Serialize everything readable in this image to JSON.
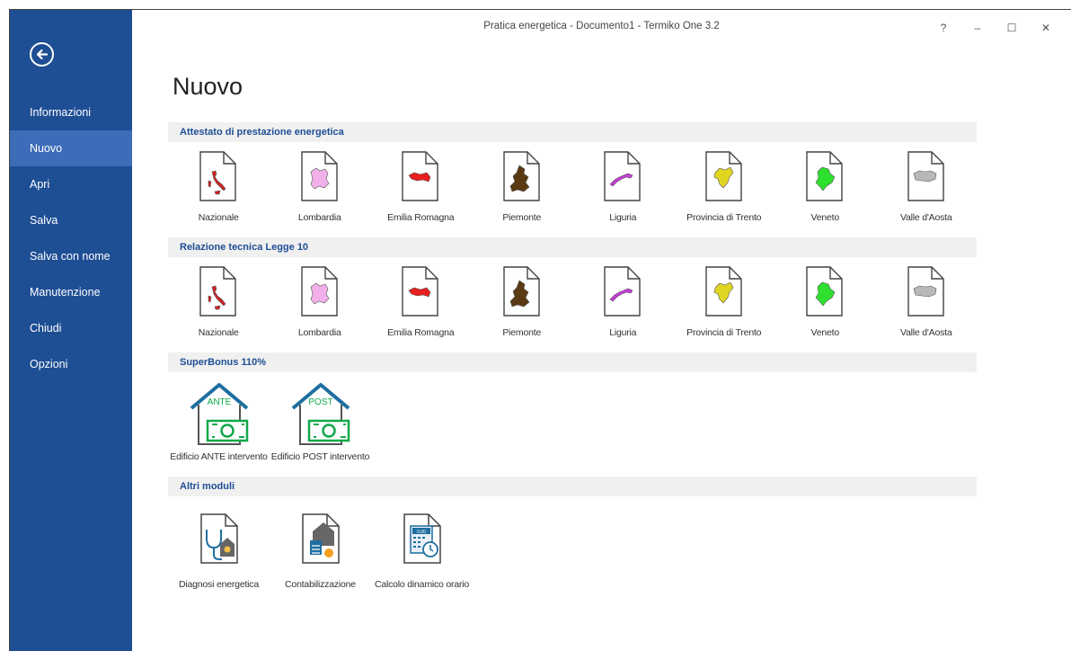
{
  "window": {
    "title": "Pratica energetica - Documento1 - Termiko One 3.2",
    "help": "?",
    "minimize": "–",
    "maximize": "☐",
    "close": "✕"
  },
  "sidebar": {
    "items": [
      {
        "label": "Informazioni",
        "active": false
      },
      {
        "label": "Nuovo",
        "active": true
      },
      {
        "label": "Apri",
        "active": false
      },
      {
        "label": "Salva",
        "active": false
      },
      {
        "label": "Salva con nome",
        "active": false
      },
      {
        "label": "Manutenzione",
        "active": false
      },
      {
        "label": "Chiudi",
        "active": false
      },
      {
        "label": "Opzioni",
        "active": false
      }
    ]
  },
  "main": {
    "title": "Nuovo",
    "sections": [
      {
        "header": "Attestato di prestazione energetica",
        "tiles": [
          {
            "label": "Nazionale",
            "icon": "italy-map-icon",
            "color": "#d22222"
          },
          {
            "label": "Lombardia",
            "icon": "lombardia-map-icon",
            "color": "#f2b0ea"
          },
          {
            "label": "Emilia Romagna",
            "icon": "emilia-romagna-map-icon",
            "color": "#e81f1f"
          },
          {
            "label": "Piemonte",
            "icon": "piemonte-map-icon",
            "color": "#5a3a12"
          },
          {
            "label": "Liguria",
            "icon": "liguria-map-icon",
            "color": "#c83ad8"
          },
          {
            "label": "Provincia di Trento",
            "icon": "trento-map-icon",
            "color": "#e0d622"
          },
          {
            "label": "Veneto",
            "icon": "veneto-map-icon",
            "color": "#2ee02e"
          },
          {
            "label": "Valle d'Aosta",
            "icon": "valle-aosta-map-icon",
            "color": "#b8b8b8"
          }
        ]
      },
      {
        "header": "Relazione tecnica Legge 10",
        "tiles": [
          {
            "label": "Nazionale",
            "icon": "italy-map-icon",
            "color": "#d22222"
          },
          {
            "label": "Lombardia",
            "icon": "lombardia-map-icon",
            "color": "#f2b0ea"
          },
          {
            "label": "Emilia Romagna",
            "icon": "emilia-romagna-map-icon",
            "color": "#e81f1f"
          },
          {
            "label": "Piemonte",
            "icon": "piemonte-map-icon",
            "color": "#5a3a12"
          },
          {
            "label": "Liguria",
            "icon": "liguria-map-icon",
            "color": "#c83ad8"
          },
          {
            "label": "Provincia di Trento",
            "icon": "trento-map-icon",
            "color": "#e0d622"
          },
          {
            "label": "Veneto",
            "icon": "veneto-map-icon",
            "color": "#2ee02e"
          },
          {
            "label": "Valle d'Aosta",
            "icon": "valle-aosta-map-icon",
            "color": "#b8b8b8"
          }
        ]
      },
      {
        "header": "SuperBonus 110%",
        "tiles": [
          {
            "label": "Edificio ANTE intervento",
            "icon": "house-money-ante-icon",
            "badge": "ANTE"
          },
          {
            "label": "Edificio POST intervento",
            "icon": "house-money-post-icon",
            "badge": "POST"
          }
        ]
      },
      {
        "header": "Altri moduli",
        "tiles": [
          {
            "label": "Diagnosi energetica",
            "icon": "stethoscope-house-icon"
          },
          {
            "label": "Contabilizzazione",
            "icon": "calculator-house-icon"
          },
          {
            "label": "Calcolo dinamico orario",
            "icon": "calculator-clock-icon",
            "badge": "0.00"
          }
        ]
      }
    ]
  },
  "colors": {
    "sidebar_bg": "#1e4e94",
    "sidebar_active": "#3d6db8",
    "section_header_text": "#1e4e94",
    "section_header_bg": "#f0f0f0",
    "house_outline": "#1e6fa0",
    "money_green": "#11a84a"
  }
}
